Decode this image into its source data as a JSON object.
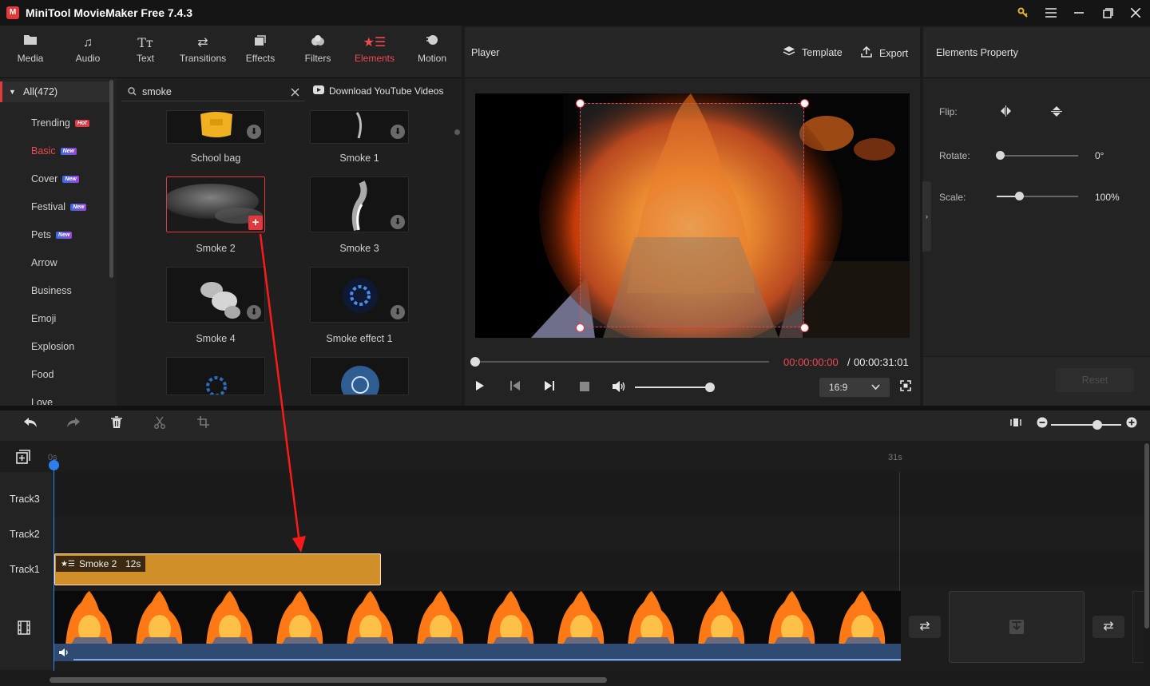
{
  "window": {
    "title": "MiniTool MovieMaker Free 7.4.3",
    "logo_text": "M",
    "controls": [
      "key-icon",
      "menu-icon",
      "minimize-icon",
      "maximize-icon",
      "close-icon"
    ]
  },
  "toolbar": {
    "tabs": [
      {
        "label": "Media",
        "icon": "media-folder-icon"
      },
      {
        "label": "Audio",
        "icon": "music-note-icon"
      },
      {
        "label": "Text",
        "icon": "text-icon"
      },
      {
        "label": "Transitions",
        "icon": "transitions-icon"
      },
      {
        "label": "Effects",
        "icon": "effects-icon"
      },
      {
        "label": "Filters",
        "icon": "filters-icon"
      },
      {
        "label": "Elements",
        "icon": "elements-icon",
        "active": true
      },
      {
        "label": "Motion",
        "icon": "motion-icon"
      }
    ],
    "active_color": "#f04a55"
  },
  "sidebar": {
    "all_label": "All(472)",
    "items": [
      {
        "label": "Trending",
        "badge": "Hot"
      },
      {
        "label": "Basic",
        "badge": "New",
        "active": true
      },
      {
        "label": "Cover",
        "badge": "New"
      },
      {
        "label": "Festival",
        "badge": "New"
      },
      {
        "label": "Pets",
        "badge": "New"
      },
      {
        "label": "Arrow"
      },
      {
        "label": "Business"
      },
      {
        "label": "Emoji"
      },
      {
        "label": "Explosion"
      },
      {
        "label": "Food"
      },
      {
        "label": "Love"
      }
    ]
  },
  "search": {
    "value": "smoke",
    "youtube_link": "Download YouTube Videos"
  },
  "grid": {
    "items": [
      {
        "label": "School bag"
      },
      {
        "label": "Smoke 1"
      },
      {
        "label": "Smoke 2",
        "selected": true
      },
      {
        "label": "Smoke 3"
      },
      {
        "label": "Smoke 4"
      },
      {
        "label": "Smoke effect 1"
      }
    ]
  },
  "player": {
    "title": "Player",
    "template_label": "Template",
    "export_label": "Export",
    "current_time": "00:00:00:00",
    "separator": "/",
    "total_time": "00:00:31:01",
    "progress_fraction": 0.0,
    "volume_fraction": 0.97,
    "aspect_ratio": "16:9"
  },
  "properties": {
    "title": "Elements Property",
    "flip_label": "Flip:",
    "rotate_label": "Rotate:",
    "rotate_value": "0°",
    "scale_label": "Scale:",
    "scale_value": "100%",
    "reset_label": "Reset"
  },
  "timeline": {
    "ruler_start": "0s",
    "ruler_end": "31s",
    "tracks": [
      "Track3",
      "Track2",
      "Track1"
    ],
    "clip": {
      "name": "Smoke 2",
      "duration": "12s",
      "color": "#d18f2a"
    },
    "zoom_fraction": 0.7
  },
  "colors": {
    "accent": "#e03a3e",
    "playhead": "#3b8cf0",
    "audio_track": "#2e4a73"
  }
}
